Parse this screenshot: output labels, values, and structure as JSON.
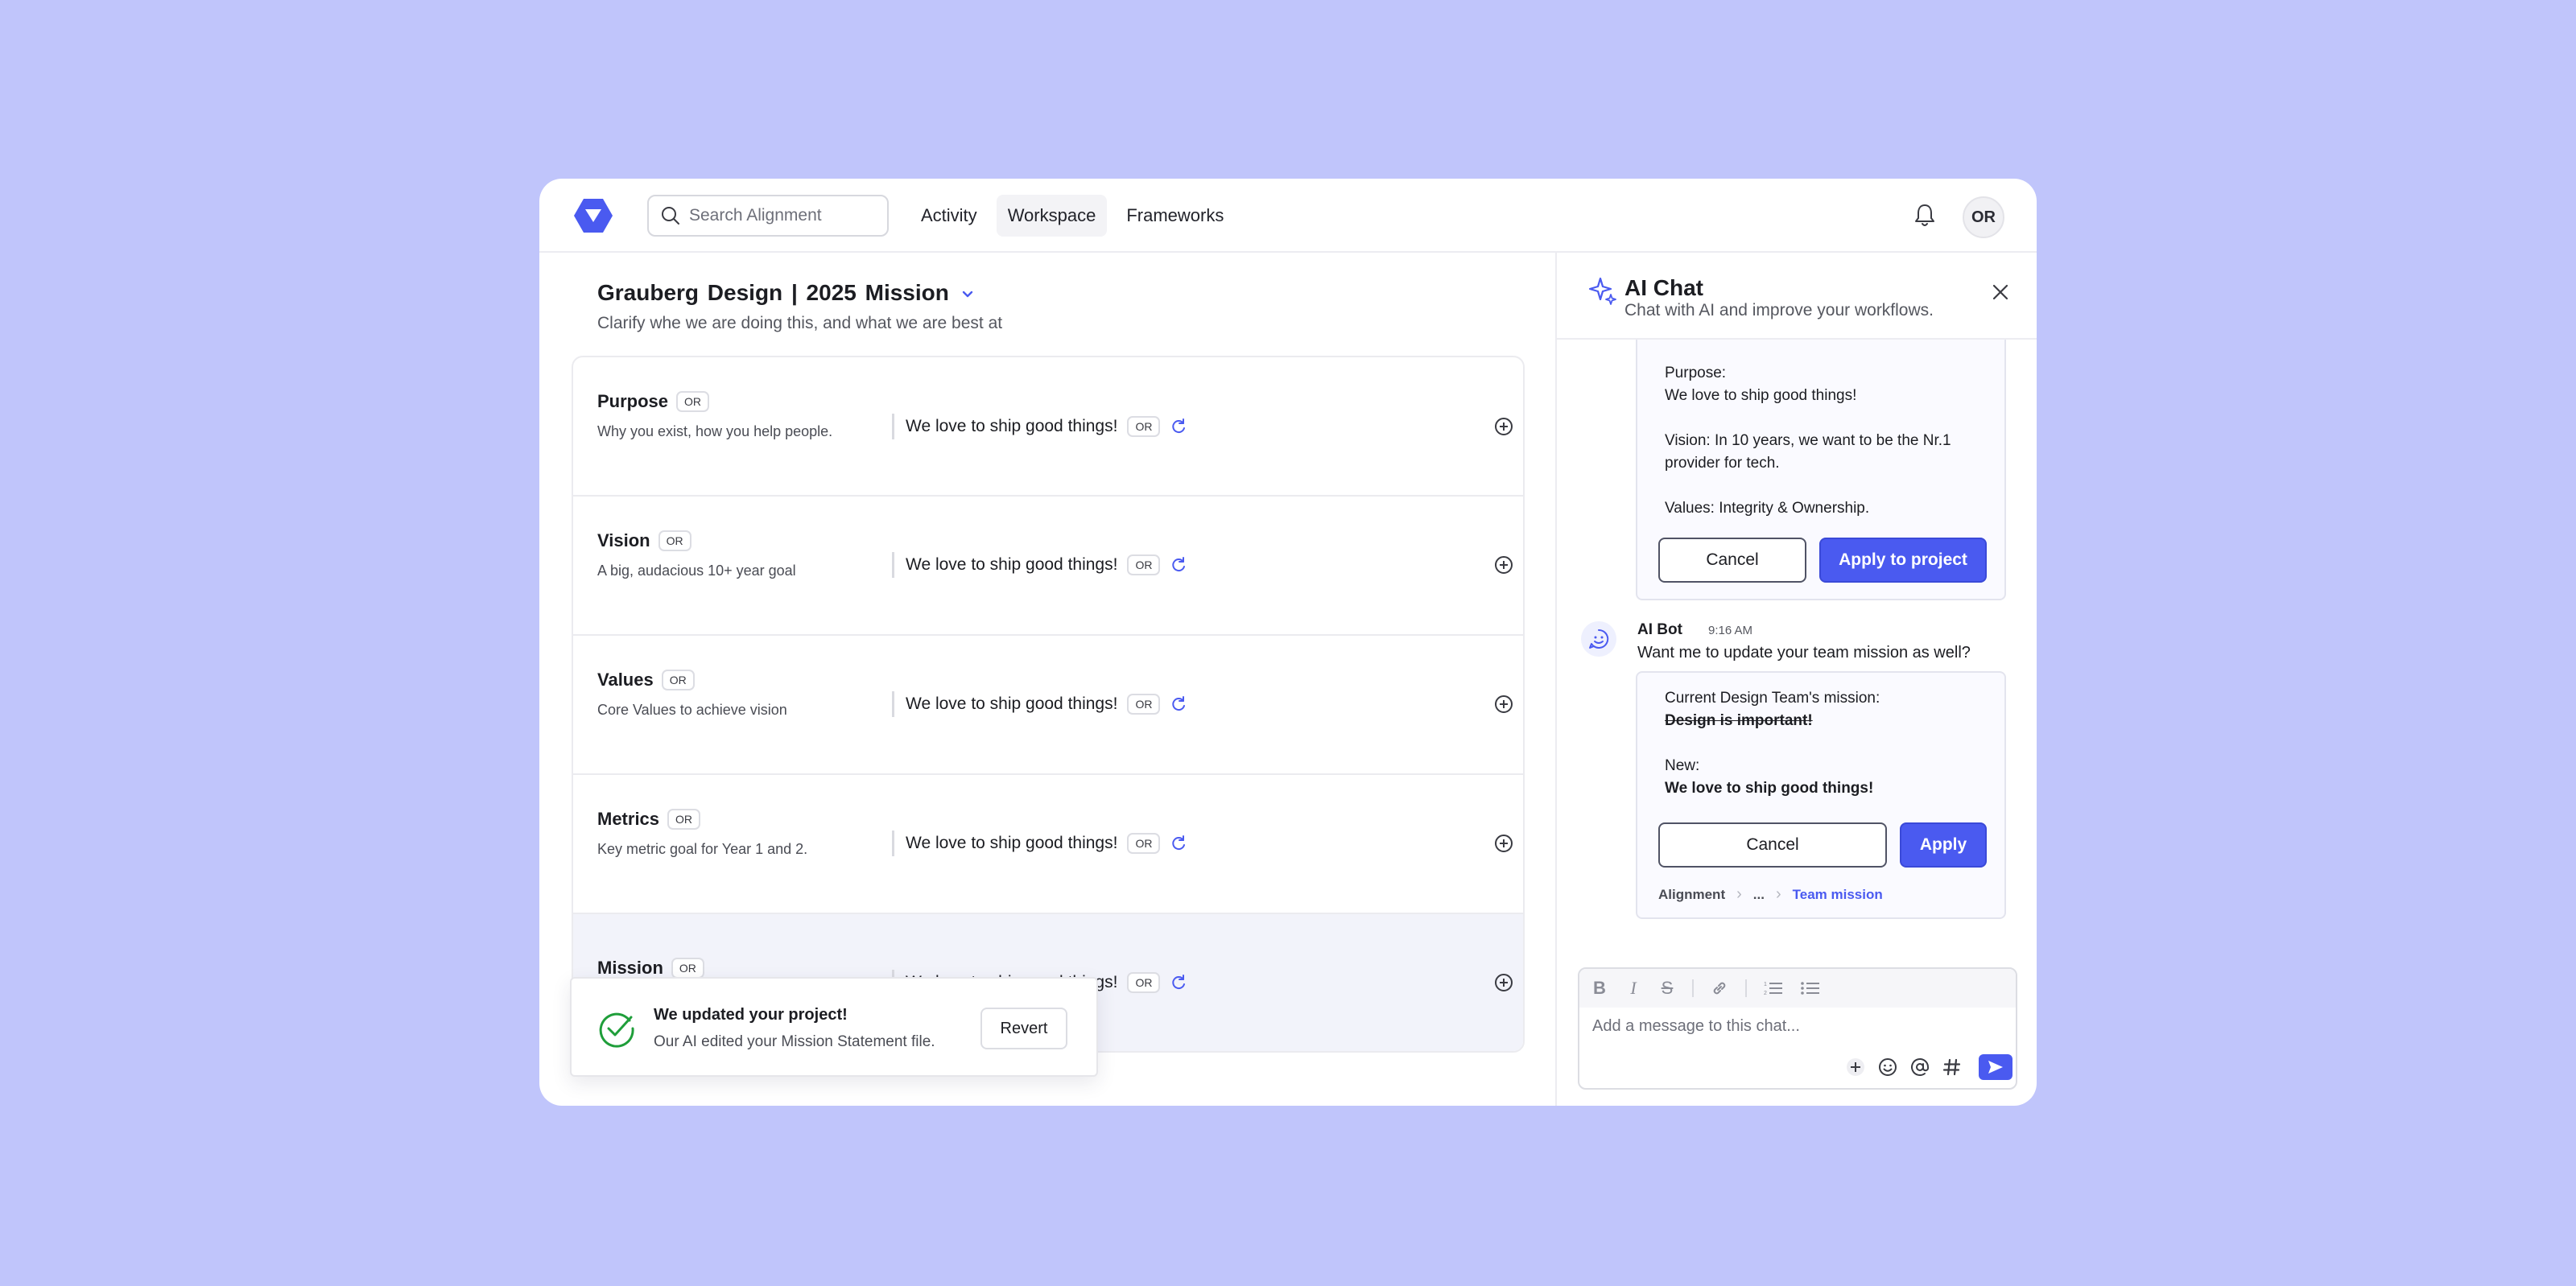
{
  "topbar": {
    "search_placeholder": "Search Alignment",
    "nav": [
      {
        "label": "Activity"
      },
      {
        "label": "Workspace",
        "active": true
      },
      {
        "label": "Frameworks"
      }
    ],
    "avatar_initials": "OR",
    "icons": [
      "logo-icon",
      "search-icon",
      "bell-icon"
    ]
  },
  "main": {
    "title": "Grauberg Design | 2025 Mission",
    "subtitle": "Clarify whe we are doing this, and what we are best at",
    "sections": [
      {
        "name": "Purpose",
        "tag": "OR",
        "desc": "Why you exist, how you help people.",
        "value": "We love to ship good things!",
        "value_tag": "OR"
      },
      {
        "name": "Vision",
        "tag": "OR",
        "desc": "A big, audacious 10+ year goal",
        "value": "We love to ship good things!",
        "value_tag": "OR"
      },
      {
        "name": "Values",
        "tag": "OR",
        "desc": "Core Values to achieve vision",
        "value": "We love to ship good things!",
        "value_tag": "OR"
      },
      {
        "name": "Metrics",
        "tag": "OR",
        "desc": "Key metric goal for Year 1 and 2.",
        "value": "We love to ship good things!",
        "value_tag": "OR"
      },
      {
        "name": "Mission",
        "tag": "OR",
        "desc": "",
        "value": "We love to ship good things!",
        "value_tag": "OR"
      }
    ]
  },
  "toast": {
    "title": "We updated your project!",
    "message": "Our AI edited your Mission Statement file.",
    "revert_label": "Revert"
  },
  "chat": {
    "title": "AI Chat",
    "subtitle": "Chat with AI and improve your workflows.",
    "card1": {
      "purpose_label": "Purpose:",
      "purpose_value": "We love to ship good things!",
      "vision_line1": "Vision: In 10 years, we want to be the Nr.1",
      "vision_line2": "provider for tech.",
      "values_line": "Values: Integrity & Ownership.",
      "cancel_label": "Cancel",
      "apply_label": "Apply to project"
    },
    "message": {
      "author": "AI Bot",
      "time": "9:16 AM",
      "text": "Want me to update your team mission as well?"
    },
    "card2": {
      "current_label": "Current Design Team's mission:",
      "current_value": "Design is important!",
      "new_label": "New:",
      "new_value": "We love to ship good things!",
      "cancel_label": "Cancel",
      "apply_label": "Apply",
      "breadcrumb": [
        "Alignment",
        "...",
        "Team mission"
      ]
    },
    "composer": {
      "placeholder": "Add a message to this chat...",
      "tools": [
        "B",
        "I",
        "S"
      ]
    }
  },
  "colors": {
    "background": "#c0c5fb",
    "accent": "#4a5af0",
    "success": "#1f9e3a"
  }
}
